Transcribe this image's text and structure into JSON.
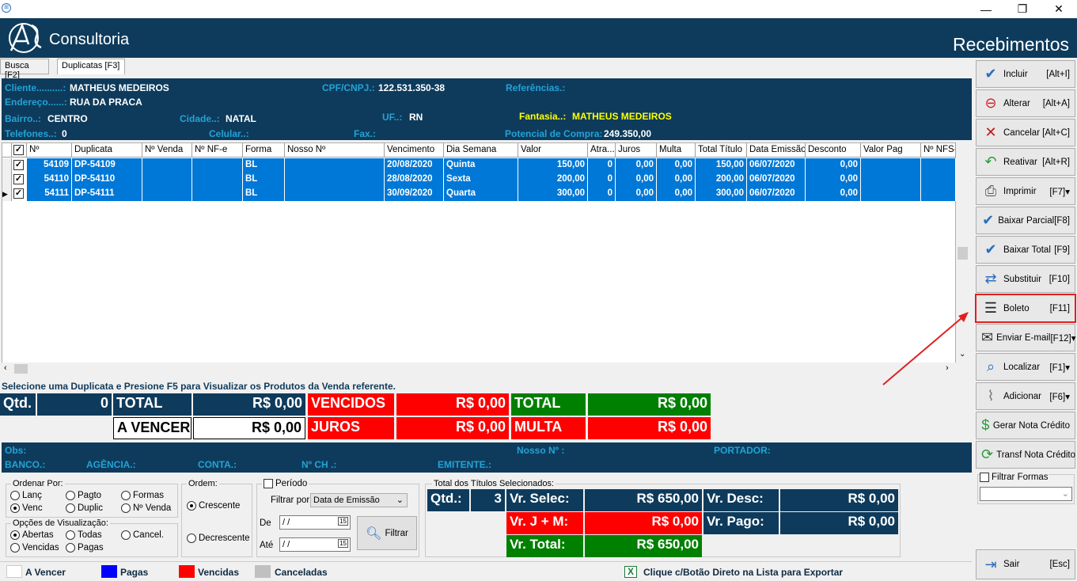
{
  "window": {
    "minimize": "—",
    "restore": "❐",
    "close": "✕"
  },
  "banner": {
    "logo_text": "Consultoria",
    "title": "Recebimentos"
  },
  "tabs": [
    {
      "label": "Busca [F2]"
    },
    {
      "label": "Duplicatas [F3]"
    }
  ],
  "client": {
    "cliente_label": "Cliente..........:",
    "cliente": "MATHEUS MEDEIROS",
    "cpf_label": "CPF/CNPJ.:",
    "cpf": "122.531.350-38",
    "ref_label": "Referências.:",
    "endereco_label": "Endereço......:",
    "endereco": "RUA DA PRACA",
    "bairro_label": "Bairro..:",
    "bairro": "CENTRO",
    "cidade_label": "Cidade..:",
    "cidade": "NATAL",
    "uf_label": "UF..:",
    "uf": "RN",
    "fantasia_label": "Fantasia..:",
    "fantasia": "MATHEUS MEDEIROS",
    "telefones_label": "Telefones..:",
    "telefones": "0",
    "celular_label": "Celular..:",
    "fax_label": "Fax.:",
    "potencial_label": "Potencial de Compra:",
    "potencial": "249.350,00"
  },
  "grid": {
    "headers": [
      "Nº",
      "Duplicata",
      "Nº Venda",
      "Nº NF-e",
      "Forma",
      "Nosso Nº",
      "Vencimento",
      "Dia Semana",
      "Valor",
      "Atra...",
      "Juros",
      "Multa",
      "Total Título",
      "Data Emissão",
      "Desconto",
      "Valor Pag",
      "Nº NFS-e"
    ],
    "rows": [
      {
        "n": "54109",
        "dup": "DP-54109",
        "forma": "BL",
        "venc": "20/08/2020",
        "dia": "Quinta",
        "valor": "150,00",
        "atraso": "0",
        "juros": "0,00",
        "multa": "0,00",
        "total": "150,00",
        "emissao": "06/07/2020",
        "desconto": "0,00"
      },
      {
        "n": "54110",
        "dup": "DP-54110",
        "forma": "BL",
        "venc": "28/08/2020",
        "dia": "Sexta",
        "valor": "200,00",
        "atraso": "0",
        "juros": "0,00",
        "multa": "0,00",
        "total": "200,00",
        "emissao": "06/07/2020",
        "desconto": "0,00"
      },
      {
        "n": "54111",
        "dup": "DP-54111",
        "forma": "BL",
        "venc": "30/09/2020",
        "dia": "Quarta",
        "valor": "300,00",
        "atraso": "0",
        "juros": "0,00",
        "multa": "0,00",
        "total": "300,00",
        "emissao": "06/07/2020",
        "desconto": "0,00"
      }
    ]
  },
  "hint": "Selecione uma Duplicata e Presione F5 para Visualizar os Produtos da Venda referente.",
  "totals": {
    "qtd_label": "Qtd.",
    "qtd": "0",
    "total_label": "TOTAL",
    "total": "R$ 0,00",
    "vencidos_label": "VENCIDOS",
    "vencidos": "R$ 0,00",
    "total2_label": "TOTAL",
    "total2": "R$ 0,00",
    "avencer_label": "A VENCER",
    "avencer": "R$ 0,00",
    "juros_label": "JUROS",
    "juros": "R$ 0,00",
    "multa_label": "MULTA",
    "multa": "R$ 0,00"
  },
  "obs": {
    "obs_label": "Obs:",
    "nosso_label": "Nosso Nº :",
    "portador_label": "PORTADOR:",
    "banco_label": "BANCO.:",
    "agencia_label": "AGÊNCIA.:",
    "conta_label": "CONTA.:",
    "nch_label": "Nº CH .:",
    "emitente_label": "EMITENTE.:"
  },
  "ordenar": {
    "legend": "Ordenar Por:",
    "opts": [
      "Lanç",
      "Pagto",
      "Formas",
      "Venc",
      "Duplic",
      "Nº Venda"
    ]
  },
  "visual": {
    "legend": "Opções de Visualização:",
    "opts": [
      "Abertas",
      "Todas",
      "Cancel.",
      "Vencidas",
      "Pagas"
    ]
  },
  "ordem": {
    "legend": "Ordem:",
    "opts": [
      "Crescente",
      "Decrescente"
    ]
  },
  "periodo": {
    "label": "Período",
    "filtrar_label": "Filtrar por:",
    "filtrar_value": "Data de Emissão",
    "de_label": "De",
    "ate_label": "Até",
    "de_value": " / /",
    "ate_value": " / /",
    "filtrar_button": "Filtrar"
  },
  "selecionados": {
    "legend": "Total dos Títulos Selecionados:",
    "qtd_label": "Qtd.:",
    "qtd": "3",
    "vrselec_label": "Vr. Selec:",
    "vrselec": "R$ 650,00",
    "vrdesc_label": "Vr. Desc:",
    "vrdesc": "R$ 0,00",
    "vrjm_label": "Vr. J + M:",
    "vrjm": "R$ 0,00",
    "vrpago_label": "Vr. Pago:",
    "vrpago": "R$ 0,00",
    "vrtotal_label": "Vr. Total:",
    "vrtotal": "R$ 650,00"
  },
  "legend": {
    "avencer": "A Vencer",
    "pagas": "Pagas",
    "vencidas": "Vencidas",
    "canceladas": "Canceladas",
    "export": "Clique c/Botão Direto na Lista para Exportar"
  },
  "sidebar": [
    {
      "label": "Incluir",
      "shortcut": "[Alt+I]"
    },
    {
      "label": "Alterar",
      "shortcut": "[Alt+A]"
    },
    {
      "label": "Cancelar",
      "shortcut": "[Alt+C]"
    },
    {
      "label": "Reativar",
      "shortcut": "[Alt+R]"
    },
    {
      "label": "Imprimir",
      "shortcut": "[F7]▾"
    },
    {
      "label": "Baixar Parcial",
      "shortcut": "[F8]"
    },
    {
      "label": "Baixar Total",
      "shortcut": "[F9]"
    },
    {
      "label": "Substituir",
      "shortcut": "[F10]"
    },
    {
      "label": "Boleto",
      "shortcut": "[F11]"
    },
    {
      "label": "Enviar E-mail",
      "shortcut": "[F12]▾"
    },
    {
      "label": "Localizar",
      "shortcut": "[F1]▾"
    },
    {
      "label": "Adicionar",
      "shortcut": "[F6]▾"
    },
    {
      "label": "Gerar Nota Crédito",
      "shortcut": ""
    },
    {
      "label": "Transf Nota Crédito",
      "shortcut": ""
    }
  ],
  "filtrar_formas": "Filtrar Formas",
  "sair": {
    "label": "Sair",
    "shortcut": "[Esc]"
  },
  "colors": {
    "navy": "#0e3b5c",
    "select_blue": "#0078d7",
    "red": "#ff0000",
    "green": "#008000",
    "highlight": "#e02020"
  }
}
